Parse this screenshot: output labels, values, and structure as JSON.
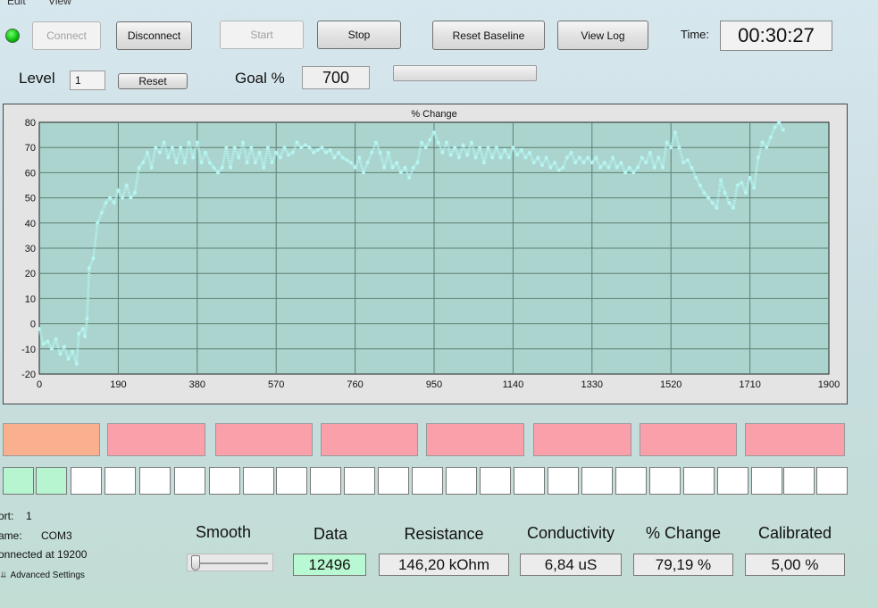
{
  "menu": [
    "Edit",
    "View"
  ],
  "toolbar": {
    "connect": "Connect",
    "disconnect": "Disconnect",
    "start": "Start",
    "stop": "Stop",
    "reset_baseline": "Reset Baseline",
    "view_log": "View Log",
    "time_label": "Time:",
    "time_value": "00:30:27"
  },
  "controls": {
    "level_label": "Level",
    "level_value": "1",
    "reset": "Reset",
    "goal_label": "Goal %",
    "goal_value": "700"
  },
  "status_colors": {
    "connection_led": "#19c219",
    "tile_active": "#faaf8f",
    "tile": "#f9a0ab",
    "cell_on": "#b6f5cf"
  },
  "chart_data": {
    "type": "scatter",
    "title": "% Change",
    "xlabel": "",
    "ylabel": "",
    "xlim": [
      0,
      1900
    ],
    "ylim": [
      -20,
      80
    ],
    "x_ticks": [
      0,
      190,
      380,
      570,
      760,
      950,
      1140,
      1330,
      1520,
      1710,
      1900
    ],
    "y_ticks": [
      80,
      70,
      60,
      50,
      40,
      30,
      20,
      10,
      0,
      -10,
      -20
    ],
    "grid": true,
    "series": [
      {
        "color": "#b6f5f2",
        "points": [
          [
            0,
            -2
          ],
          [
            10,
            -8
          ],
          [
            20,
            -7
          ],
          [
            30,
            -10
          ],
          [
            40,
            -6
          ],
          [
            50,
            -12
          ],
          [
            60,
            -9
          ],
          [
            70,
            -14
          ],
          [
            80,
            -11
          ],
          [
            90,
            -16
          ],
          [
            95,
            -4
          ],
          [
            105,
            -2
          ],
          [
            110,
            -5
          ],
          [
            115,
            2
          ],
          [
            120,
            22
          ],
          [
            130,
            26
          ],
          [
            140,
            40
          ],
          [
            150,
            44
          ],
          [
            160,
            48
          ],
          [
            170,
            50
          ],
          [
            180,
            48
          ],
          [
            190,
            53
          ],
          [
            200,
            50
          ],
          [
            210,
            55
          ],
          [
            220,
            50
          ],
          [
            230,
            52
          ],
          [
            240,
            62
          ],
          [
            250,
            64
          ],
          [
            260,
            68
          ],
          [
            270,
            62
          ],
          [
            280,
            70
          ],
          [
            290,
            68
          ],
          [
            300,
            72
          ],
          [
            310,
            66
          ],
          [
            320,
            70
          ],
          [
            330,
            64
          ],
          [
            340,
            70
          ],
          [
            350,
            64
          ],
          [
            360,
            72
          ],
          [
            370,
            66
          ],
          [
            380,
            72
          ],
          [
            390,
            64
          ],
          [
            400,
            68
          ],
          [
            410,
            64
          ],
          [
            420,
            62
          ],
          [
            430,
            60
          ],
          [
            440,
            62
          ],
          [
            450,
            70
          ],
          [
            460,
            62
          ],
          [
            470,
            70
          ],
          [
            480,
            66
          ],
          [
            490,
            72
          ],
          [
            500,
            64
          ],
          [
            510,
            70
          ],
          [
            520,
            64
          ],
          [
            530,
            68
          ],
          [
            540,
            62
          ],
          [
            550,
            70
          ],
          [
            560,
            64
          ],
          [
            570,
            68
          ],
          [
            580,
            66
          ],
          [
            590,
            70
          ],
          [
            600,
            67
          ],
          [
            610,
            68
          ],
          [
            620,
            72
          ],
          [
            630,
            70
          ],
          [
            640,
            71
          ],
          [
            650,
            70
          ],
          [
            660,
            68
          ],
          [
            670,
            69
          ],
          [
            680,
            70
          ],
          [
            690,
            68
          ],
          [
            700,
            69
          ],
          [
            710,
            66
          ],
          [
            720,
            68
          ],
          [
            730,
            66
          ],
          [
            740,
            65
          ],
          [
            750,
            64
          ],
          [
            760,
            62
          ],
          [
            770,
            66
          ],
          [
            780,
            60
          ],
          [
            790,
            64
          ],
          [
            800,
            68
          ],
          [
            810,
            72
          ],
          [
            820,
            68
          ],
          [
            830,
            62
          ],
          [
            840,
            68
          ],
          [
            850,
            62
          ],
          [
            860,
            64
          ],
          [
            870,
            60
          ],
          [
            880,
            62
          ],
          [
            890,
            58
          ],
          [
            900,
            62
          ],
          [
            910,
            64
          ],
          [
            920,
            72
          ],
          [
            930,
            70
          ],
          [
            940,
            73
          ],
          [
            950,
            76
          ],
          [
            960,
            72
          ],
          [
            970,
            68
          ],
          [
            980,
            72
          ],
          [
            990,
            67
          ],
          [
            1000,
            70
          ],
          [
            1010,
            66
          ],
          [
            1020,
            71
          ],
          [
            1030,
            67
          ],
          [
            1040,
            72
          ],
          [
            1050,
            66
          ],
          [
            1060,
            70
          ],
          [
            1070,
            64
          ],
          [
            1080,
            70
          ],
          [
            1090,
            66
          ],
          [
            1100,
            70
          ],
          [
            1110,
            66
          ],
          [
            1120,
            69
          ],
          [
            1130,
            66
          ],
          [
            1140,
            70
          ],
          [
            1150,
            67
          ],
          [
            1160,
            69
          ],
          [
            1170,
            66
          ],
          [
            1180,
            68
          ],
          [
            1190,
            64
          ],
          [
            1200,
            66
          ],
          [
            1210,
            63
          ],
          [
            1220,
            66
          ],
          [
            1230,
            62
          ],
          [
            1240,
            64
          ],
          [
            1250,
            61
          ],
          [
            1260,
            62
          ],
          [
            1270,
            66
          ],
          [
            1280,
            68
          ],
          [
            1290,
            64
          ],
          [
            1300,
            66
          ],
          [
            1310,
            64
          ],
          [
            1320,
            66
          ],
          [
            1330,
            64
          ],
          [
            1340,
            66
          ],
          [
            1350,
            62
          ],
          [
            1360,
            64
          ],
          [
            1370,
            62
          ],
          [
            1380,
            66
          ],
          [
            1390,
            62
          ],
          [
            1400,
            64
          ],
          [
            1410,
            60
          ],
          [
            1420,
            62
          ],
          [
            1430,
            60
          ],
          [
            1440,
            62
          ],
          [
            1450,
            66
          ],
          [
            1460,
            64
          ],
          [
            1470,
            68
          ],
          [
            1480,
            62
          ],
          [
            1490,
            66
          ],
          [
            1500,
            62
          ],
          [
            1510,
            72
          ],
          [
            1520,
            70
          ],
          [
            1530,
            76
          ],
          [
            1540,
            70
          ],
          [
            1550,
            64
          ],
          [
            1560,
            65
          ],
          [
            1570,
            62
          ],
          [
            1580,
            58
          ],
          [
            1590,
            55
          ],
          [
            1600,
            52
          ],
          [
            1610,
            50
          ],
          [
            1620,
            48
          ],
          [
            1630,
            46
          ],
          [
            1640,
            57
          ],
          [
            1650,
            52
          ],
          [
            1660,
            48
          ],
          [
            1670,
            46
          ],
          [
            1680,
            55
          ],
          [
            1690,
            56
          ],
          [
            1700,
            52
          ],
          [
            1710,
            58
          ],
          [
            1720,
            54
          ],
          [
            1730,
            66
          ],
          [
            1740,
            72
          ],
          [
            1750,
            70
          ],
          [
            1760,
            74
          ],
          [
            1770,
            78
          ],
          [
            1780,
            80
          ],
          [
            1790,
            77
          ]
        ]
      }
    ]
  },
  "indicator_tiles": 8,
  "indicator_cells_on": 2,
  "indicator_cells_total": 25,
  "info": {
    "port_label": "ort:",
    "port_value": "1",
    "name_label": "ame:",
    "name_value": "COM3",
    "connected_text": "onnected at 19200",
    "advanced_settings": "Advanced Settings"
  },
  "readouts": {
    "smooth_label": "Smooth",
    "smooth_value": 0,
    "data_label": "Data",
    "data_value": "12496",
    "resistance_label": "Resistance",
    "resistance_value": "146,20 kOhm",
    "conductivity_label": "Conductivity",
    "conductivity_value": "6,84 uS",
    "change_label": "% Change",
    "change_value": "79,19 %",
    "calibrated_label": "Calibrated",
    "calibrated_value": "5,00 %"
  }
}
